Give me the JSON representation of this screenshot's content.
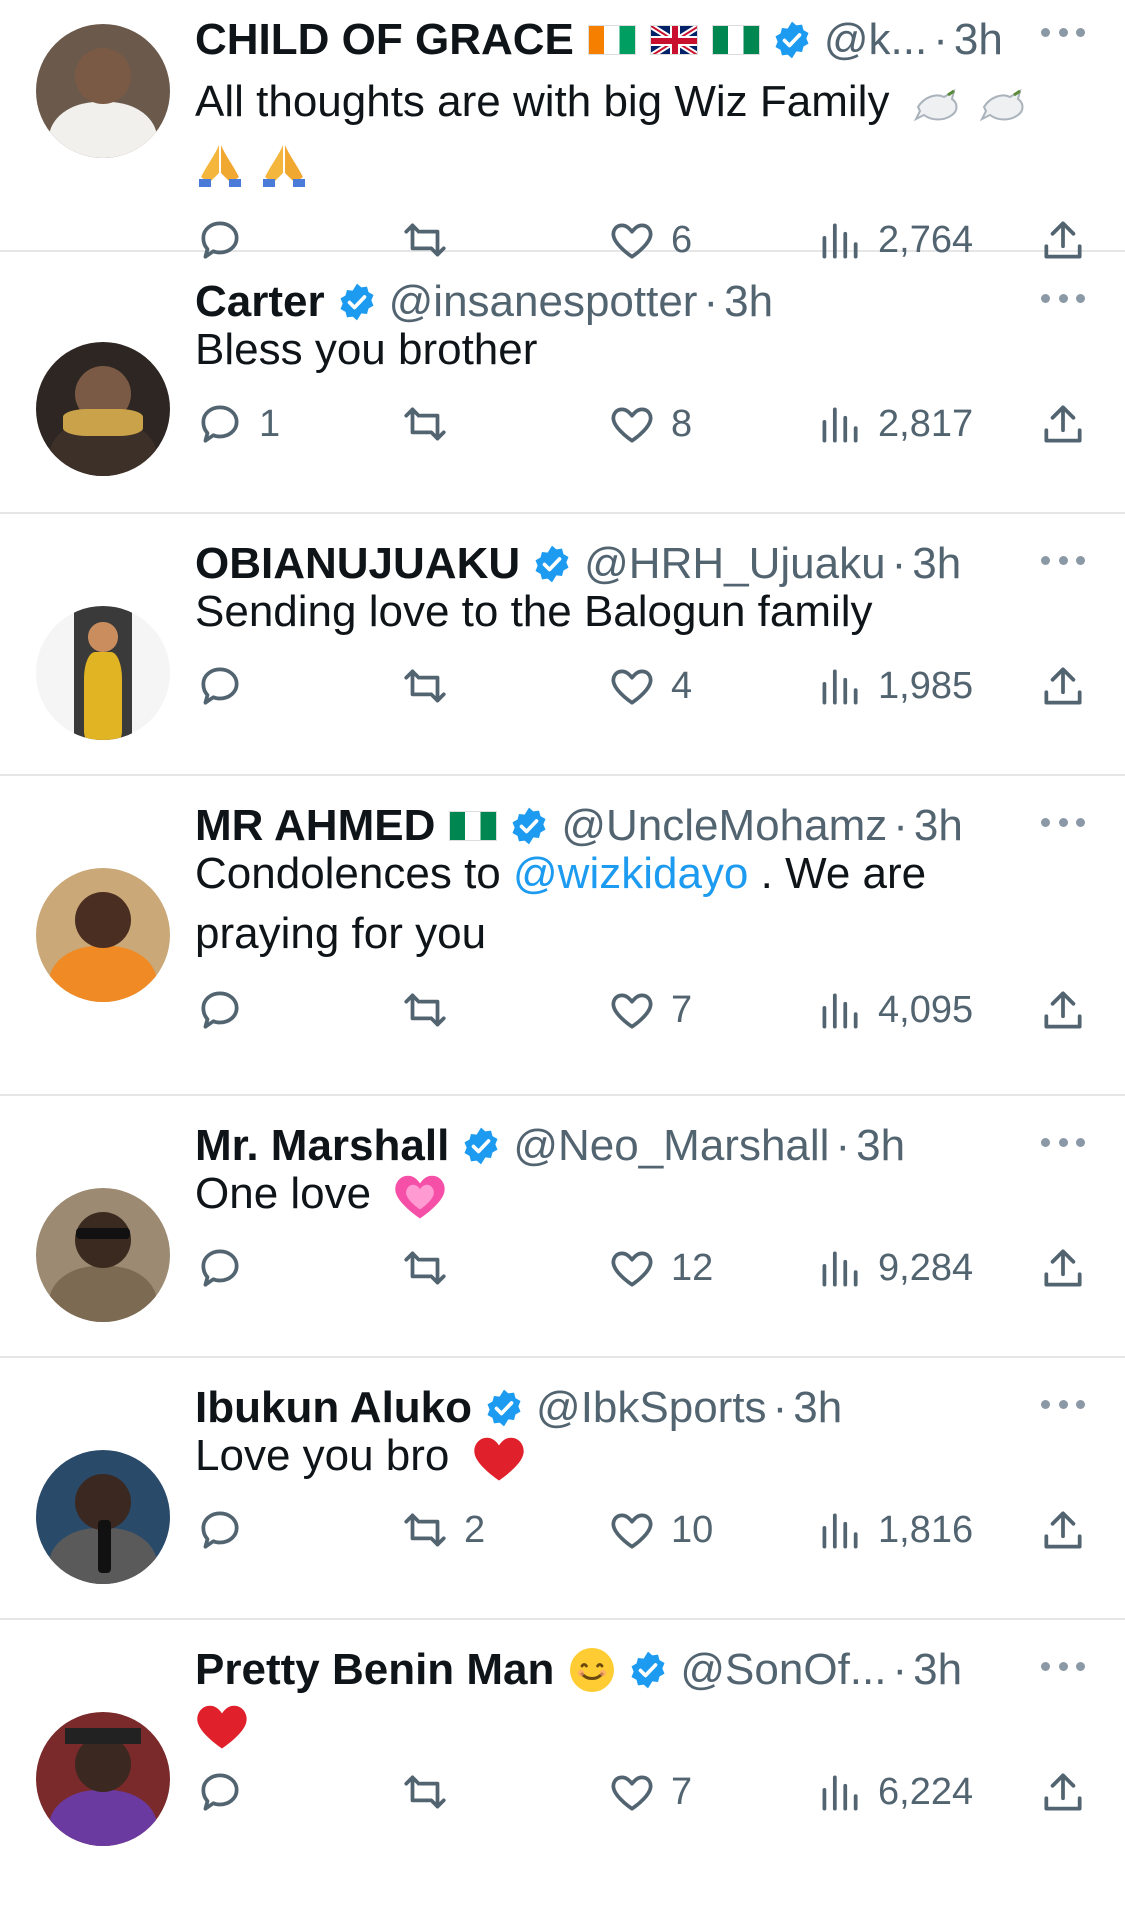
{
  "tweets": [
    {
      "name": "CHILD OF GRACE",
      "flags": [
        "ci",
        "gb",
        "ng"
      ],
      "handle": "@k...",
      "time": "3h",
      "text": "All thoughts are with big Wiz Family",
      "emojis_after": [
        "dove",
        "dove"
      ],
      "second_line_emojis": [
        "pray",
        "pray"
      ],
      "reply_count": "",
      "retweet_count": "",
      "like_count": "6",
      "view_count": "2,764",
      "avatar_colors": [
        "#6b5a4c",
        "#f2f0ec",
        "#7a5a44"
      ]
    },
    {
      "name": "Carter",
      "handle": "@insanespotter",
      "time": "3h",
      "text": "Bless you brother",
      "reply_count": "1",
      "retweet_count": "",
      "like_count": "8",
      "view_count": "2,817",
      "avatar_colors": [
        "#2e2622",
        "#c9a24a",
        "#3d3028"
      ]
    },
    {
      "name": "OBIANUJUAKU",
      "handle": "@HRH_Ujuaku",
      "time": "3h",
      "text": "Sending love to the Balogun family",
      "reply_count": "",
      "retweet_count": "",
      "like_count": "4",
      "view_count": "1,985",
      "avatar_colors": [
        "#3a3a3a",
        "#c98d5e",
        "#e1b424"
      ]
    },
    {
      "name": "MR AHMED",
      "flags": [
        "ng"
      ],
      "handle": "@UncleMohamz",
      "time": "3h",
      "text_before": "Condolences to",
      "mention": "@wizkidayo",
      "text_after": ". We are praying for you",
      "reply_count": "",
      "retweet_count": "",
      "like_count": "7",
      "view_count": "4,095",
      "avatar_colors": [
        "#caa877",
        "#4a2e22",
        "#f08a24"
      ]
    },
    {
      "name": "Mr. Marshall",
      "handle": "@Neo_Marshall",
      "time": "3h",
      "text": "One love",
      "reply_count": "",
      "retweet_count": "",
      "like_count": "12",
      "view_count": "9,284",
      "avatar_colors": [
        "#9c8a72",
        "#3b2a20",
        "#7c6a52"
      ]
    },
    {
      "name": "Ibukun Aluko",
      "handle": "@IbkSports",
      "time": "3h",
      "text": "Love you bro",
      "reply_count": "",
      "retweet_count": "2",
      "like_count": "10",
      "view_count": "1,816",
      "avatar_colors": [
        "#2a4a6a",
        "#3b2820",
        "#5a5a5a"
      ]
    },
    {
      "name": "Pretty Benin Man",
      "handle": "@SonOf...",
      "time": "3h",
      "text": "",
      "reply_count": "",
      "retweet_count": "",
      "like_count": "7",
      "view_count": "6,224",
      "avatar_colors": [
        "#7a2a2a",
        "#3b2820",
        "#6a3aa0"
      ]
    }
  ],
  "colors": {
    "verified": "#1d9bf0",
    "mention": "#1d9bf0",
    "muted": "#536471",
    "heart_red": "#e0202a",
    "heart_pink": "#f54fa8"
  }
}
